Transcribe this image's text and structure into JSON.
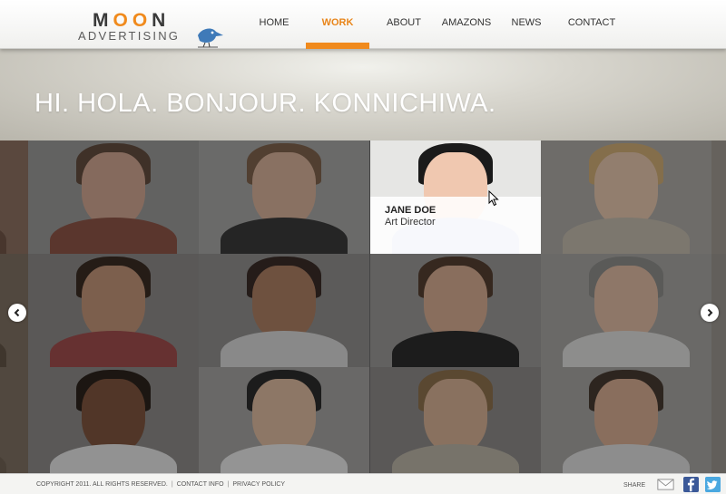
{
  "logo": {
    "word1_a": "M",
    "word1_oo": "OO",
    "word1_b": "N",
    "word2": "ADVERTISING"
  },
  "nav": {
    "items": [
      {
        "label": "HOME",
        "active": false
      },
      {
        "label": "WORK",
        "active": true
      },
      {
        "label": "ABOUT",
        "active": false
      },
      {
        "label": "AMAZONS",
        "active": false
      },
      {
        "label": "NEWS",
        "active": false
      },
      {
        "label": "CONTACT",
        "active": false
      }
    ]
  },
  "hero": {
    "title": "HI. HOLA. BONJOUR. KONNICHIWA."
  },
  "caption": {
    "name": "JANE DOE",
    "role": "Art Director"
  },
  "footer": {
    "copyright": "COPYRIGHT 2011. ALL RIGHTS RESERVED.",
    "contact": "CONTACT INFO",
    "privacy": "PRIVACY POLICY",
    "share": "SHARE"
  },
  "icons": {
    "prev": "chevron-left-icon",
    "next": "chevron-right-icon",
    "mail": "mail-icon",
    "facebook": "facebook-icon",
    "twitter": "twitter-icon"
  },
  "colors": {
    "accent": "#f08a1c",
    "text": "#333333"
  }
}
